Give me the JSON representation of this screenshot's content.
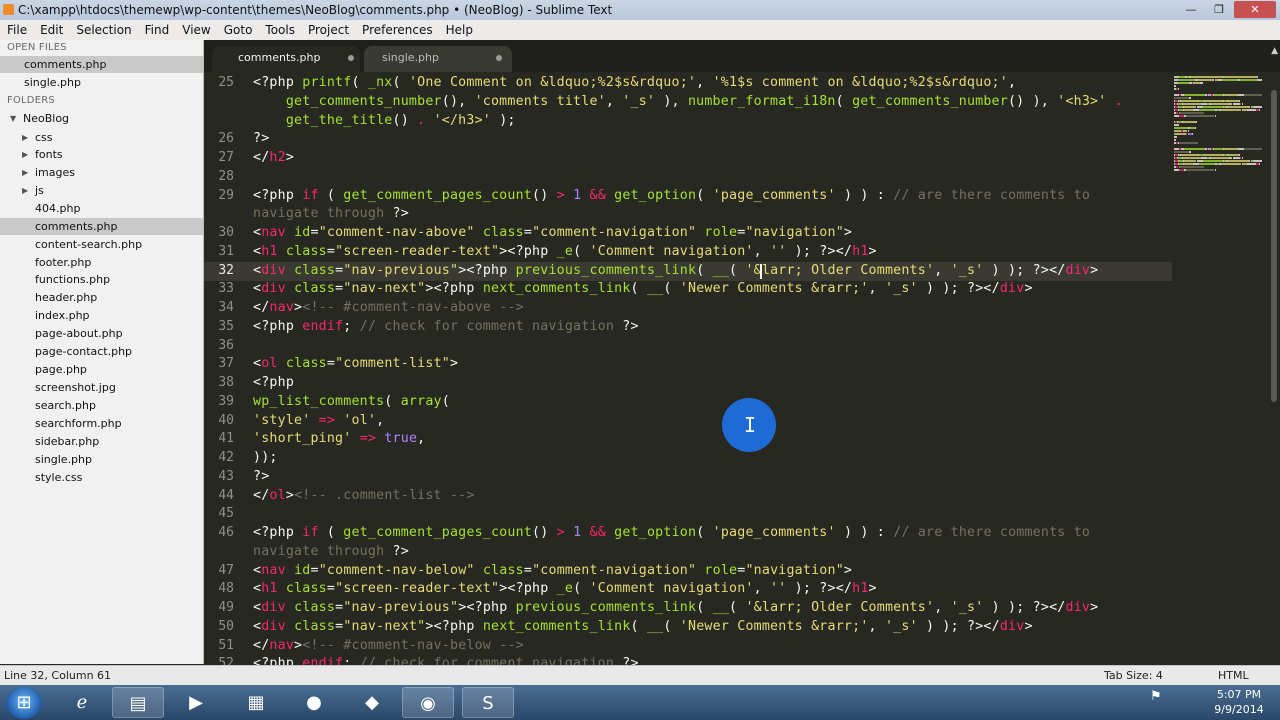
{
  "window": {
    "title": "C:\\xampp\\htdocs\\themewp\\wp-content\\themes\\NeoBlog\\comments.php • (NeoBlog) - Sublime Text",
    "minimize": "—",
    "maximize": "❐",
    "close": "✕"
  },
  "menu": [
    "File",
    "Edit",
    "Selection",
    "Find",
    "View",
    "Goto",
    "Tools",
    "Project",
    "Preferences",
    "Help"
  ],
  "sidebar": {
    "open_files_heading": "OPEN FILES",
    "open_files": [
      {
        "name": "comments.php",
        "active": true
      },
      {
        "name": "single.php",
        "active": false
      }
    ],
    "folders_heading": "FOLDERS",
    "root_folder": "NeoBlog",
    "subfolders": [
      "css",
      "fonts",
      "images",
      "js"
    ],
    "files": [
      "404.php",
      "comments.php",
      "content-search.php",
      "footer.php",
      "functions.php",
      "header.php",
      "index.php",
      "page-about.php",
      "page-contact.php",
      "page.php",
      "screenshot.jpg",
      "search.php",
      "searchform.php",
      "sidebar.php",
      "single.php",
      "style.css"
    ],
    "active_file": "comments.php"
  },
  "tabs": [
    {
      "label": "comments.php",
      "active": true
    },
    {
      "label": "single.php",
      "active": false
    }
  ],
  "editor": {
    "current_line": "32",
    "line_numbers": [
      "25",
      "",
      "",
      "26",
      "27",
      "28",
      "29",
      "",
      "30",
      "31",
      "32",
      "33",
      "34",
      "35",
      "36",
      "37",
      "38",
      "39",
      "40",
      "41",
      "42",
      "43",
      "44",
      "45",
      "46",
      "",
      "47",
      "48",
      "49",
      "50",
      "51",
      "52"
    ],
    "lines": [
      [
        [
          "ph",
          "<?php "
        ],
        [
          "fn",
          "printf"
        ],
        [
          "ph",
          "( "
        ],
        [
          "fn",
          "_nx"
        ],
        [
          "ph",
          "( "
        ],
        [
          "st",
          "'One Comment on &ldquo;%2$s&rdquo;'"
        ],
        [
          "ph",
          ", "
        ],
        [
          "st",
          "'%1$s comment on &ldquo;%2$s&rdquo;'"
        ],
        [
          "ph",
          ","
        ]
      ],
      [
        [
          "ph",
          "    "
        ],
        [
          "fn",
          "get_comments_number"
        ],
        [
          "ph",
          "(), "
        ],
        [
          "st",
          "'comments title'"
        ],
        [
          "ph",
          ", "
        ],
        [
          "st",
          "'_s'"
        ],
        [
          "ph",
          " ), "
        ],
        [
          "fn",
          "number_format_i18n"
        ],
        [
          "ph",
          "( "
        ],
        [
          "fn",
          "get_comments_number"
        ],
        [
          "ph",
          "() ), "
        ],
        [
          "st",
          "'<h3>'"
        ],
        [
          "kw",
          " ."
        ]
      ],
      [
        [
          "ph",
          "    "
        ],
        [
          "fn",
          "get_the_title"
        ],
        [
          "ph",
          "() "
        ],
        [
          "kw",
          "."
        ],
        [
          "ph",
          " "
        ],
        [
          "st",
          "'</h3>'"
        ],
        [
          "ph",
          " );"
        ]
      ],
      [
        [
          "ph",
          "?>"
        ]
      ],
      [
        [
          "ph",
          "</"
        ],
        [
          "tg",
          "h2"
        ],
        [
          "ph",
          ">"
        ]
      ],
      [
        [
          "ph",
          ""
        ]
      ],
      [
        [
          "ph",
          "<?php "
        ],
        [
          "kw",
          "if"
        ],
        [
          "ph",
          " ( "
        ],
        [
          "fn",
          "get_comment_pages_count"
        ],
        [
          "ph",
          "() "
        ],
        [
          "kw",
          ">"
        ],
        [
          "ph",
          " "
        ],
        [
          "nu",
          "1"
        ],
        [
          "ph",
          " "
        ],
        [
          "kw",
          "&&"
        ],
        [
          "ph",
          " "
        ],
        [
          "fn",
          "get_option"
        ],
        [
          "ph",
          "( "
        ],
        [
          "st",
          "'page_comments'"
        ],
        [
          "ph",
          " ) ) : "
        ],
        [
          "cm",
          "// are there comments to"
        ]
      ],
      [
        [
          "cm",
          "navigate through "
        ],
        [
          "ph",
          "?>"
        ]
      ],
      [
        [
          "ph",
          "<"
        ],
        [
          "tg",
          "nav"
        ],
        [
          "ph",
          " "
        ],
        [
          "at",
          "id"
        ],
        [
          "ph",
          "="
        ],
        [
          "st",
          "\"comment-nav-above\""
        ],
        [
          "ph",
          " "
        ],
        [
          "at",
          "class"
        ],
        [
          "ph",
          "="
        ],
        [
          "st",
          "\"comment-navigation\""
        ],
        [
          "ph",
          " "
        ],
        [
          "at",
          "role"
        ],
        [
          "ph",
          "="
        ],
        [
          "st",
          "\"navigation\""
        ],
        [
          "ph",
          ">"
        ]
      ],
      [
        [
          "ph",
          "<"
        ],
        [
          "tg",
          "h1"
        ],
        [
          "ph",
          " "
        ],
        [
          "at",
          "class"
        ],
        [
          "ph",
          "="
        ],
        [
          "st",
          "\"screen-reader-text\""
        ],
        [
          "ph",
          "><?php "
        ],
        [
          "fn",
          "_e"
        ],
        [
          "ph",
          "( "
        ],
        [
          "st",
          "'Comment navigation'"
        ],
        [
          "ph",
          ", "
        ],
        [
          "st",
          "''"
        ],
        [
          "ph",
          " ); ?></"
        ],
        [
          "tg",
          "h1"
        ],
        [
          "ph",
          ">"
        ]
      ],
      [
        [
          "ph",
          "<"
        ],
        [
          "tg",
          "div"
        ],
        [
          "ph",
          " "
        ],
        [
          "at",
          "class"
        ],
        [
          "ph",
          "="
        ],
        [
          "st",
          "\"nav-previous\""
        ],
        [
          "ph",
          "><?php "
        ],
        [
          "fn",
          "previous_comments_link"
        ],
        [
          "ph",
          "( "
        ],
        [
          "fn",
          "__"
        ],
        [
          "ph",
          "( "
        ],
        [
          "st",
          "'&larr; Older Comments'"
        ],
        [
          "ph",
          ", "
        ],
        [
          "st",
          "'_s'"
        ],
        [
          "ph",
          " ) ); ?></"
        ],
        [
          "tg",
          "div"
        ],
        [
          "ph",
          ">"
        ]
      ],
      [
        [
          "ph",
          "<"
        ],
        [
          "tg",
          "div"
        ],
        [
          "ph",
          " "
        ],
        [
          "at",
          "class"
        ],
        [
          "ph",
          "="
        ],
        [
          "st",
          "\"nav-next\""
        ],
        [
          "ph",
          "><?php "
        ],
        [
          "fn",
          "next_comments_link"
        ],
        [
          "ph",
          "( "
        ],
        [
          "fn",
          "__"
        ],
        [
          "ph",
          "( "
        ],
        [
          "st",
          "'Newer Comments &rarr;'"
        ],
        [
          "ph",
          ", "
        ],
        [
          "st",
          "'_s'"
        ],
        [
          "ph",
          " ) ); ?></"
        ],
        [
          "tg",
          "div"
        ],
        [
          "ph",
          ">"
        ]
      ],
      [
        [
          "ph",
          "</"
        ],
        [
          "tg",
          "nav"
        ],
        [
          "ph",
          ">"
        ],
        [
          "cm",
          "<!-- #comment-nav-above -->"
        ]
      ],
      [
        [
          "ph",
          "<?php "
        ],
        [
          "kw",
          "endif"
        ],
        [
          "ph",
          "; "
        ],
        [
          "cm",
          "// check for comment navigation "
        ],
        [
          "ph",
          "?>"
        ]
      ],
      [
        [
          "ph",
          ""
        ]
      ],
      [
        [
          "ph",
          "<"
        ],
        [
          "tg",
          "ol"
        ],
        [
          "ph",
          " "
        ],
        [
          "at",
          "class"
        ],
        [
          "ph",
          "="
        ],
        [
          "st",
          "\"comment-list\""
        ],
        [
          "ph",
          ">"
        ]
      ],
      [
        [
          "ph",
          "<?php"
        ]
      ],
      [
        [
          "fn",
          "wp_list_comments"
        ],
        [
          "ph",
          "( "
        ],
        [
          "fn",
          "array"
        ],
        [
          "ph",
          "("
        ]
      ],
      [
        [
          "st",
          "'style'"
        ],
        [
          "ph",
          " "
        ],
        [
          "kw",
          "=>"
        ],
        [
          "ph",
          " "
        ],
        [
          "st",
          "'ol'"
        ],
        [
          "ph",
          ","
        ]
      ],
      [
        [
          "st",
          "'short_ping'"
        ],
        [
          "ph",
          " "
        ],
        [
          "kw",
          "=>"
        ],
        [
          "ph",
          " "
        ],
        [
          "nu",
          "true"
        ],
        [
          "ph",
          ","
        ]
      ],
      [
        [
          "ph",
          "));"
        ]
      ],
      [
        [
          "ph",
          "?>"
        ]
      ],
      [
        [
          "ph",
          "</"
        ],
        [
          "tg",
          "ol"
        ],
        [
          "ph",
          ">"
        ],
        [
          "cm",
          "<!-- .comment-list -->"
        ]
      ],
      [
        [
          "ph",
          ""
        ]
      ],
      [
        [
          "ph",
          "<?php "
        ],
        [
          "kw",
          "if"
        ],
        [
          "ph",
          " ( "
        ],
        [
          "fn",
          "get_comment_pages_count"
        ],
        [
          "ph",
          "() "
        ],
        [
          "kw",
          ">"
        ],
        [
          "ph",
          " "
        ],
        [
          "nu",
          "1"
        ],
        [
          "ph",
          " "
        ],
        [
          "kw",
          "&&"
        ],
        [
          "ph",
          " "
        ],
        [
          "fn",
          "get_option"
        ],
        [
          "ph",
          "( "
        ],
        [
          "st",
          "'page_comments'"
        ],
        [
          "ph",
          " ) ) : "
        ],
        [
          "cm",
          "// are there comments to"
        ]
      ],
      [
        [
          "cm",
          "navigate through "
        ],
        [
          "ph",
          "?>"
        ]
      ],
      [
        [
          "ph",
          "<"
        ],
        [
          "tg",
          "nav"
        ],
        [
          "ph",
          " "
        ],
        [
          "at",
          "id"
        ],
        [
          "ph",
          "="
        ],
        [
          "st",
          "\"comment-nav-below\""
        ],
        [
          "ph",
          " "
        ],
        [
          "at",
          "class"
        ],
        [
          "ph",
          "="
        ],
        [
          "st",
          "\"comment-navigation\""
        ],
        [
          "ph",
          " "
        ],
        [
          "at",
          "role"
        ],
        [
          "ph",
          "="
        ],
        [
          "st",
          "\"navigation\""
        ],
        [
          "ph",
          ">"
        ]
      ],
      [
        [
          "ph",
          "<"
        ],
        [
          "tg",
          "h1"
        ],
        [
          "ph",
          " "
        ],
        [
          "at",
          "class"
        ],
        [
          "ph",
          "="
        ],
        [
          "st",
          "\"screen-reader-text\""
        ],
        [
          "ph",
          "><?php "
        ],
        [
          "fn",
          "_e"
        ],
        [
          "ph",
          "( "
        ],
        [
          "st",
          "'Comment navigation'"
        ],
        [
          "ph",
          ", "
        ],
        [
          "st",
          "''"
        ],
        [
          "ph",
          " ); ?></"
        ],
        [
          "tg",
          "h1"
        ],
        [
          "ph",
          ">"
        ]
      ],
      [
        [
          "ph",
          "<"
        ],
        [
          "tg",
          "div"
        ],
        [
          "ph",
          " "
        ],
        [
          "at",
          "class"
        ],
        [
          "ph",
          "="
        ],
        [
          "st",
          "\"nav-previous\""
        ],
        [
          "ph",
          "><?php "
        ],
        [
          "fn",
          "previous_comments_link"
        ],
        [
          "ph",
          "( "
        ],
        [
          "fn",
          "__"
        ],
        [
          "ph",
          "( "
        ],
        [
          "st",
          "'&larr; Older Comments'"
        ],
        [
          "ph",
          ", "
        ],
        [
          "st",
          "'_s'"
        ],
        [
          "ph",
          " ) ); ?></"
        ],
        [
          "tg",
          "div"
        ],
        [
          "ph",
          ">"
        ]
      ],
      [
        [
          "ph",
          "<"
        ],
        [
          "tg",
          "div"
        ],
        [
          "ph",
          " "
        ],
        [
          "at",
          "class"
        ],
        [
          "ph",
          "="
        ],
        [
          "st",
          "\"nav-next\""
        ],
        [
          "ph",
          "><?php "
        ],
        [
          "fn",
          "next_comments_link"
        ],
        [
          "ph",
          "( "
        ],
        [
          "fn",
          "__"
        ],
        [
          "ph",
          "( "
        ],
        [
          "st",
          "'Newer Comments &rarr;'"
        ],
        [
          "ph",
          ", "
        ],
        [
          "st",
          "'_s'"
        ],
        [
          "ph",
          " ) ); ?></"
        ],
        [
          "tg",
          "div"
        ],
        [
          "ph",
          ">"
        ]
      ],
      [
        [
          "ph",
          "</"
        ],
        [
          "tg",
          "nav"
        ],
        [
          "ph",
          ">"
        ],
        [
          "cm",
          "<!-- #comment-nav-below -->"
        ]
      ],
      [
        [
          "ph",
          "<?php "
        ],
        [
          "kw",
          "endif"
        ],
        [
          "ph",
          "; "
        ],
        [
          "cm",
          "// check for comment navigation "
        ],
        [
          "ph",
          "?>"
        ]
      ]
    ]
  },
  "colors": {
    "editor_bg": "#272822",
    "keyword": "#f92672",
    "function": "#a6e22e",
    "string": "#e6db74",
    "comment": "#75715e",
    "number": "#ae81ff",
    "plain": "#f8f8f2"
  },
  "status": {
    "position": "Line 32, Column 61",
    "tab_size": "Tab Size: 4",
    "syntax": "HTML"
  },
  "taskbar": {
    "items": [
      "windows-start-icon",
      "internet-explorer-icon",
      "file-explorer-icon",
      "media-player-icon",
      "notepad-icon",
      "firefox-icon",
      "unknown-app-icon",
      "chrome-icon",
      "sublime-text-icon"
    ],
    "clock_time": "5:07 PM",
    "clock_date": "9/9/2014"
  }
}
